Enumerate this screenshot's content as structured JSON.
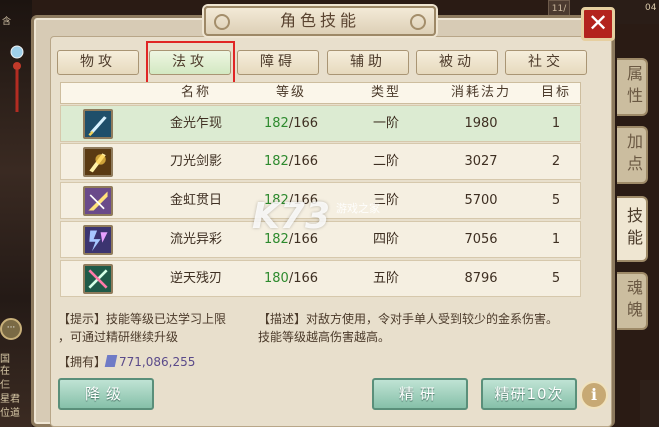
{
  "window": {
    "title": "角色技能",
    "close_label": "✕"
  },
  "background": {
    "chip_label": "11/",
    "top_number": "04",
    "left_top_text": "含",
    "left_texts": [
      "国",
      "在",
      "仨",
      "星君",
      "位道"
    ]
  },
  "side_tabs": [
    {
      "label": "属性",
      "active": false
    },
    {
      "label": "加点",
      "active": false
    },
    {
      "label": "技能",
      "active": true
    },
    {
      "label": "魂魄",
      "active": false
    }
  ],
  "categories": [
    {
      "label": "物攻",
      "selected": false
    },
    {
      "label": "法攻",
      "selected": true
    },
    {
      "label": "障碍",
      "selected": false
    },
    {
      "label": "辅助",
      "selected": false
    },
    {
      "label": "被动",
      "selected": false
    },
    {
      "label": "社交",
      "selected": false
    }
  ],
  "table": {
    "headers": [
      "名称",
      "等级",
      "类型",
      "消耗法力",
      "目标"
    ],
    "rows": [
      {
        "icon": "sword-icon",
        "name": "金光乍现",
        "level_current": "182",
        "level_max": "/166",
        "type": "一阶",
        "mana": "1980",
        "target": "1"
      },
      {
        "icon": "blade-icon",
        "name": "刀光剑影",
        "level_current": "182",
        "level_max": "/166",
        "type": "二阶",
        "mana": "3027",
        "target": "2"
      },
      {
        "icon": "sun-beam-icon",
        "name": "金虹贯日",
        "level_current": "182",
        "level_max": "/166",
        "type": "三阶",
        "mana": "5700",
        "target": "5"
      },
      {
        "icon": "lightning-icon",
        "name": "流光异彩",
        "level_current": "182",
        "level_max": "/166",
        "type": "四阶",
        "mana": "7056",
        "target": "1"
      },
      {
        "icon": "crossed-blades-icon",
        "name": "逆天残刃",
        "level_current": "180",
        "level_max": "/166",
        "type": "五阶",
        "mana": "8796",
        "target": "5"
      }
    ]
  },
  "watermark": {
    "text": "K73",
    "sub": "游戏之家"
  },
  "notes": {
    "tip_line1": "【提示】技能等级已达学习上限",
    "tip_line2": "，可通过精研继续升级",
    "desc_line1": "【描述】对敌方使用，令对手单人受到较少的金系伤害。",
    "desc_line2": "技能等级越高伤害越高。",
    "own_label": "【拥有】",
    "own_value": "771,086,255"
  },
  "buttons": {
    "downgrade": "降级",
    "refine": "精研",
    "refine10": "精研10次",
    "info": "i"
  },
  "colors": {
    "level_green": "#2e8a2e",
    "accent_red": "#b3231d",
    "button_teal": "#86c0a9"
  }
}
